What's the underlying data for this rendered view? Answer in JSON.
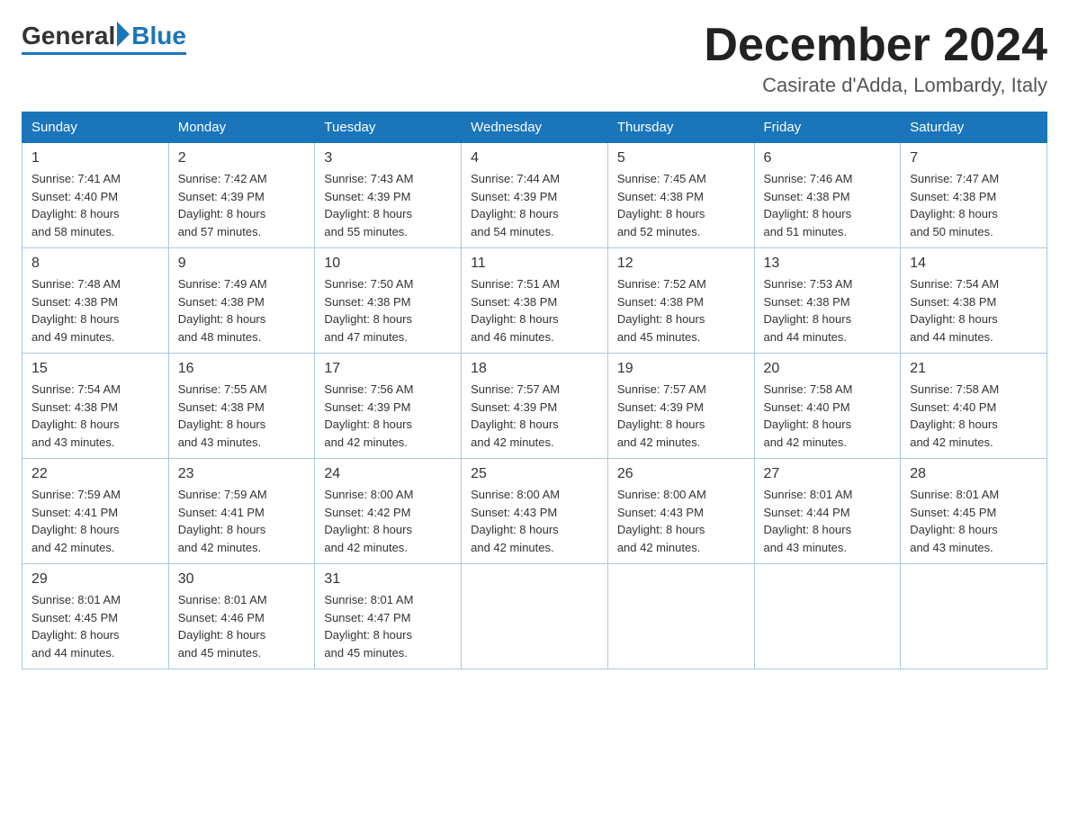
{
  "logo": {
    "general": "General",
    "blue": "Blue"
  },
  "title": "December 2024",
  "subtitle": "Casirate d'Adda, Lombardy, Italy",
  "weekdays": [
    "Sunday",
    "Monday",
    "Tuesday",
    "Wednesday",
    "Thursday",
    "Friday",
    "Saturday"
  ],
  "weeks": [
    [
      {
        "day": "1",
        "sunrise": "7:41 AM",
        "sunset": "4:40 PM",
        "daylight": "8 hours and 58 minutes."
      },
      {
        "day": "2",
        "sunrise": "7:42 AM",
        "sunset": "4:39 PM",
        "daylight": "8 hours and 57 minutes."
      },
      {
        "day": "3",
        "sunrise": "7:43 AM",
        "sunset": "4:39 PM",
        "daylight": "8 hours and 55 minutes."
      },
      {
        "day": "4",
        "sunrise": "7:44 AM",
        "sunset": "4:39 PM",
        "daylight": "8 hours and 54 minutes."
      },
      {
        "day": "5",
        "sunrise": "7:45 AM",
        "sunset": "4:38 PM",
        "daylight": "8 hours and 52 minutes."
      },
      {
        "day": "6",
        "sunrise": "7:46 AM",
        "sunset": "4:38 PM",
        "daylight": "8 hours and 51 minutes."
      },
      {
        "day": "7",
        "sunrise": "7:47 AM",
        "sunset": "4:38 PM",
        "daylight": "8 hours and 50 minutes."
      }
    ],
    [
      {
        "day": "8",
        "sunrise": "7:48 AM",
        "sunset": "4:38 PM",
        "daylight": "8 hours and 49 minutes."
      },
      {
        "day": "9",
        "sunrise": "7:49 AM",
        "sunset": "4:38 PM",
        "daylight": "8 hours and 48 minutes."
      },
      {
        "day": "10",
        "sunrise": "7:50 AM",
        "sunset": "4:38 PM",
        "daylight": "8 hours and 47 minutes."
      },
      {
        "day": "11",
        "sunrise": "7:51 AM",
        "sunset": "4:38 PM",
        "daylight": "8 hours and 46 minutes."
      },
      {
        "day": "12",
        "sunrise": "7:52 AM",
        "sunset": "4:38 PM",
        "daylight": "8 hours and 45 minutes."
      },
      {
        "day": "13",
        "sunrise": "7:53 AM",
        "sunset": "4:38 PM",
        "daylight": "8 hours and 44 minutes."
      },
      {
        "day": "14",
        "sunrise": "7:54 AM",
        "sunset": "4:38 PM",
        "daylight": "8 hours and 44 minutes."
      }
    ],
    [
      {
        "day": "15",
        "sunrise": "7:54 AM",
        "sunset": "4:38 PM",
        "daylight": "8 hours and 43 minutes."
      },
      {
        "day": "16",
        "sunrise": "7:55 AM",
        "sunset": "4:38 PM",
        "daylight": "8 hours and 43 minutes."
      },
      {
        "day": "17",
        "sunrise": "7:56 AM",
        "sunset": "4:39 PM",
        "daylight": "8 hours and 42 minutes."
      },
      {
        "day": "18",
        "sunrise": "7:57 AM",
        "sunset": "4:39 PM",
        "daylight": "8 hours and 42 minutes."
      },
      {
        "day": "19",
        "sunrise": "7:57 AM",
        "sunset": "4:39 PM",
        "daylight": "8 hours and 42 minutes."
      },
      {
        "day": "20",
        "sunrise": "7:58 AM",
        "sunset": "4:40 PM",
        "daylight": "8 hours and 42 minutes."
      },
      {
        "day": "21",
        "sunrise": "7:58 AM",
        "sunset": "4:40 PM",
        "daylight": "8 hours and 42 minutes."
      }
    ],
    [
      {
        "day": "22",
        "sunrise": "7:59 AM",
        "sunset": "4:41 PM",
        "daylight": "8 hours and 42 minutes."
      },
      {
        "day": "23",
        "sunrise": "7:59 AM",
        "sunset": "4:41 PM",
        "daylight": "8 hours and 42 minutes."
      },
      {
        "day": "24",
        "sunrise": "8:00 AM",
        "sunset": "4:42 PM",
        "daylight": "8 hours and 42 minutes."
      },
      {
        "day": "25",
        "sunrise": "8:00 AM",
        "sunset": "4:43 PM",
        "daylight": "8 hours and 42 minutes."
      },
      {
        "day": "26",
        "sunrise": "8:00 AM",
        "sunset": "4:43 PM",
        "daylight": "8 hours and 42 minutes."
      },
      {
        "day": "27",
        "sunrise": "8:01 AM",
        "sunset": "4:44 PM",
        "daylight": "8 hours and 43 minutes."
      },
      {
        "day": "28",
        "sunrise": "8:01 AM",
        "sunset": "4:45 PM",
        "daylight": "8 hours and 43 minutes."
      }
    ],
    [
      {
        "day": "29",
        "sunrise": "8:01 AM",
        "sunset": "4:45 PM",
        "daylight": "8 hours and 44 minutes."
      },
      {
        "day": "30",
        "sunrise": "8:01 AM",
        "sunset": "4:46 PM",
        "daylight": "8 hours and 45 minutes."
      },
      {
        "day": "31",
        "sunrise": "8:01 AM",
        "sunset": "4:47 PM",
        "daylight": "8 hours and 45 minutes."
      },
      null,
      null,
      null,
      null
    ]
  ],
  "labels": {
    "sunrise": "Sunrise:",
    "sunset": "Sunset:",
    "daylight": "Daylight:"
  }
}
